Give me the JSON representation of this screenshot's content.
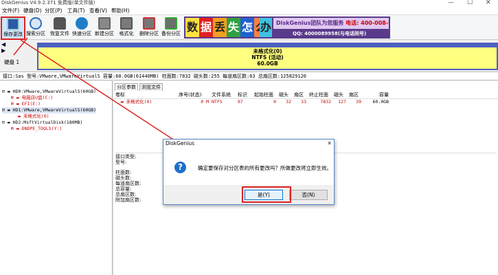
{
  "window": {
    "title": "DiskGenius V4.9.2.371 免费版(单文件版)"
  },
  "menu": [
    "文件(F)",
    "硬盘(D)",
    "分区(P)",
    "工具(T)",
    "查看(V)",
    "帮助(H)"
  ],
  "toolbar": [
    {
      "label": "保存更改",
      "icon": "save-icon"
    },
    {
      "label": "搜索分区",
      "icon": "search-partition-icon"
    },
    {
      "label": "恢复文件",
      "icon": "recover-files-icon"
    },
    {
      "label": "快速分区",
      "icon": "quick-partition-icon"
    },
    {
      "label": "新建分区",
      "icon": "new-partition-icon"
    },
    {
      "label": "格式化",
      "icon": "format-icon"
    },
    {
      "label": "删除分区",
      "icon": "delete-partition-icon"
    },
    {
      "label": "备份分区",
      "icon": "backup-partition-icon"
    }
  ],
  "banner": {
    "chars": [
      "数",
      "据",
      "丢",
      "失",
      "怎",
      "么",
      "办"
    ],
    "brand": "DiskGenius团队为您服务",
    "phone": "电话: 400-008-9958",
    "qq": "QQ: 4000089958(与电话同号)"
  },
  "diskmap": {
    "disk_label": "硬盘 1",
    "partition_name": "未格式化(0)",
    "partition_fs": "NTFS (活动)",
    "partition_size": "60.0GB"
  },
  "infobar": "接口:Sas  型号:VMware,VMwareVirtualS  容量:60.0GB(61440MB)  柱面数:7832  磁头数:255  每道扇区数:63  总扇区数:125829120",
  "tree": [
    "HD0:VMware,VMwareVirtualS(60GB)",
    "电脑店U盘(C:)",
    "EFI(E:)",
    "HD1:VMware,VMwareVirtualS(60GB)",
    "未格式化(0)",
    "HD2:MsftVirtualDisk(180MB)",
    "DNDPE_TOOLS(Y:)"
  ],
  "tabs": [
    "分区参数",
    "浏览文件"
  ],
  "table": {
    "headers": [
      "卷标",
      "序号(状态)",
      "文件系统",
      "标识",
      "起始柱面",
      "磁头",
      "扇区",
      "终止柱面",
      "磁头",
      "扇区",
      "容量"
    ],
    "row": [
      "未格式化(0)",
      "0 M",
      "NTFS",
      "07",
      "0",
      "32",
      "33",
      "7832",
      "127",
      "39",
      "60.0GB"
    ]
  },
  "params": {
    "labels1": [
      "接口类型:",
      "型号:"
    ],
    "labels2": [
      "柱面数:",
      "磁头数:",
      "每道扇区数:",
      "总容量:",
      "总扇区数:",
      "附加扇区数:"
    ]
  },
  "dialog": {
    "title": "DiskGenius",
    "message": "确定要保存对分区表的所有更改吗？所做更改将立即生效。",
    "yes": "是(Y)",
    "no": "否(N)"
  }
}
